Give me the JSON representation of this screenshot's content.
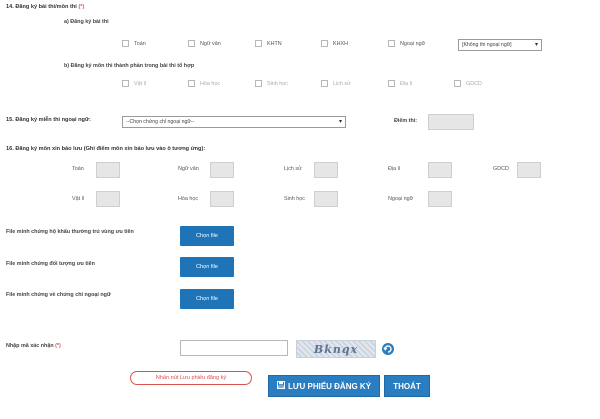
{
  "section14": {
    "title": "14. Đăng ký bài thi/môn thi",
    "required": "(*)",
    "a_title": "a) Đăng ký bài thi",
    "a_items": [
      "Toán",
      "Ngữ văn",
      "KHTN",
      "KHXH",
      "Ngoại ngữ"
    ],
    "language_select": "[Không thi ngoại ngữ]",
    "b_title": "b) Đăng ký môn thi thành phần trong bài thi tổ hợp",
    "b_items": [
      "Vật lí",
      "Hóa học",
      "Sinh học",
      "Lịch sử",
      "Địa lí",
      "GDCD"
    ]
  },
  "section15": {
    "title": "15. Đăng ký miễn thi ngoại ngữ:",
    "select_placeholder": "--Chọn chứng chỉ ngoại ngữ--",
    "score_label": "Điểm thi:"
  },
  "section16": {
    "title": "16. Đăng ký môn xin bảo lưu (Ghi điểm môn xin bảo lưu vào ô tương ứng):",
    "row1": [
      "Toán",
      "Ngữ văn",
      "Lịch sử",
      "Địa lí",
      "GDCD"
    ],
    "row2": [
      "Vật lí",
      "Hóa học",
      "Sinh học",
      "Ngoại ngữ"
    ]
  },
  "files": [
    {
      "label": "File minh chứng hộ khẩu thường trú vùng ưu tiên",
      "button": "Chọn file"
    },
    {
      "label": "File minh chứng đối tượng ưu tiên",
      "button": "Chọn file"
    },
    {
      "label": "File minh chứng về chứng chỉ ngoại ngữ",
      "button": "Chọn file"
    }
  ],
  "captcha": {
    "label": "Nhập mã xác nhận",
    "required": "(*)",
    "code": "Bknqx"
  },
  "actions": {
    "callout": "Nhấn nút Lưu phiếu đăng ký",
    "save": "LƯU PHIẾU ĐĂNG KÝ",
    "exit": "THOÁT"
  }
}
